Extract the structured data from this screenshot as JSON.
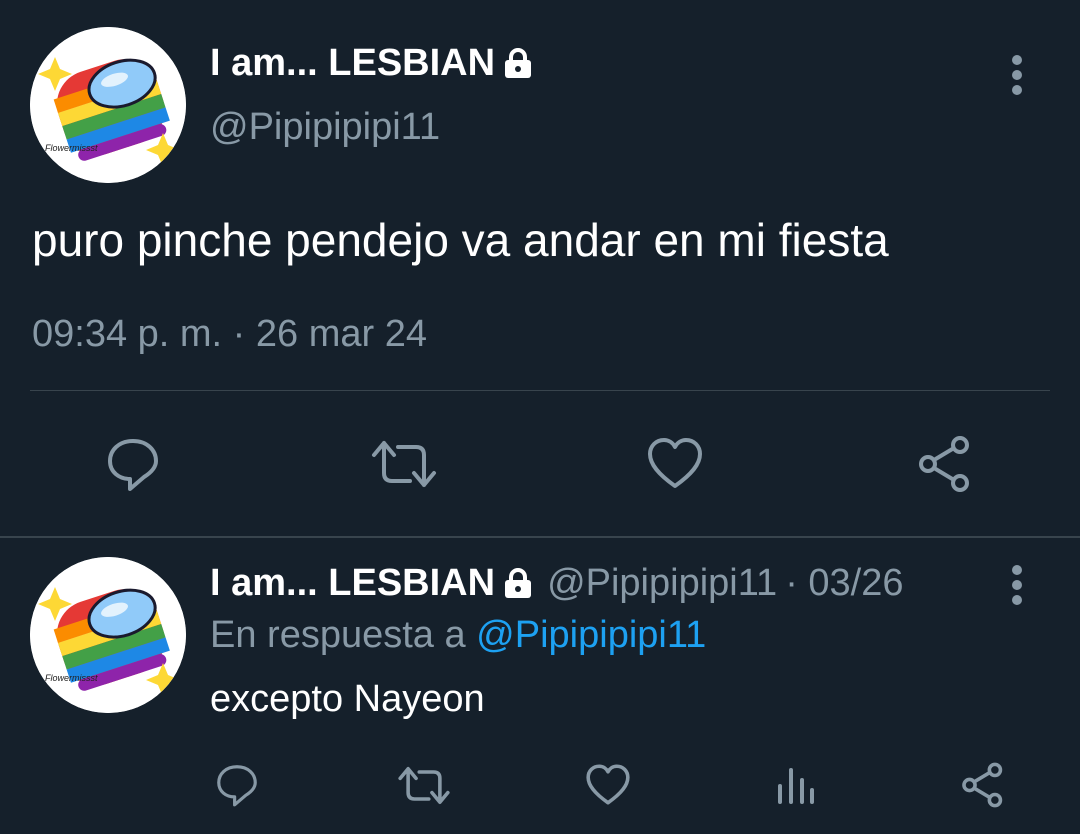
{
  "main_tweet": {
    "display_name": "I am... LESBIAN",
    "handle": "@Pipipipipi11",
    "text": "puro pinche pendejo va andar en mi fiesta",
    "timestamp": "09:34 p. m. · 26 mar 24",
    "avatar_watermark": "_Flowermissst",
    "icons": [
      "lock-icon",
      "more-vert-icon",
      "reply-icon",
      "retweet-icon",
      "like-icon",
      "share-icon"
    ]
  },
  "reply_tweet": {
    "display_name": "I am... LESBIAN",
    "handle": "@Pipipipipi11",
    "date": "· 03/26",
    "reply_prefix": "En respuesta a",
    "reply_to": "@Pipipipipi11",
    "text": "excepto Nayeon",
    "avatar_watermark": "_Flowermissst",
    "icons": [
      "lock-icon",
      "more-vert-icon",
      "reply-icon",
      "retweet-icon",
      "like-icon",
      "analytics-icon",
      "share-icon"
    ]
  },
  "colors": {
    "background": "#15202b",
    "text_primary": "#ffffff",
    "text_secondary": "#8899a6",
    "accent": "#1da1f2",
    "divider": "#38444d"
  }
}
